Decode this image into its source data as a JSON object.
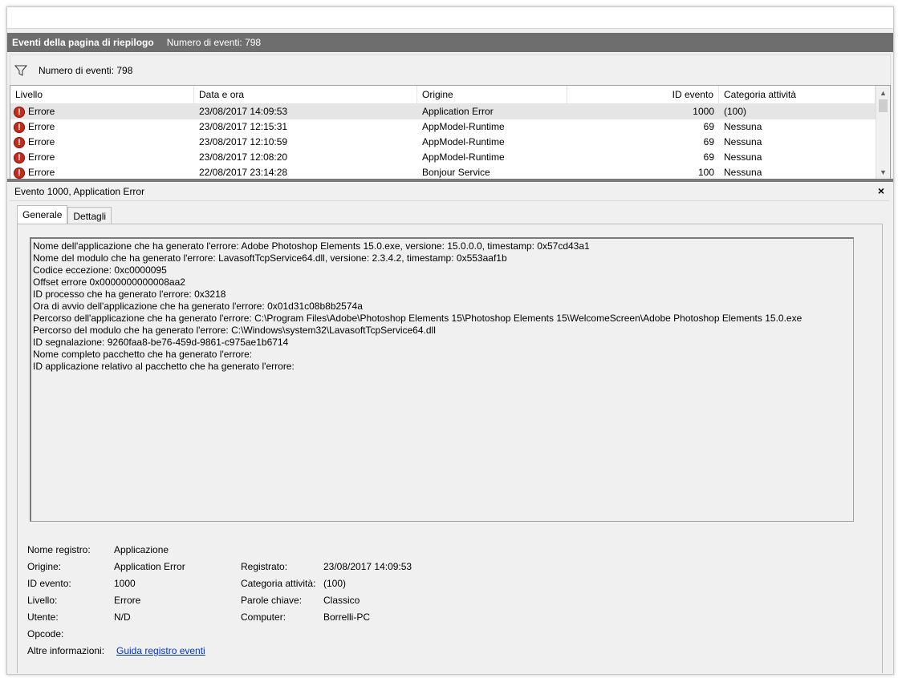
{
  "header": {
    "title": "Eventi della pagina di riepilogo",
    "count": "Numero di eventi: 798"
  },
  "filter": {
    "icon": "filter-icon",
    "text": "Numero di eventi: 798"
  },
  "grid": {
    "columns": {
      "level": "Livello",
      "datetime": "Data e ora",
      "source": "Origine",
      "event_id": "ID evento",
      "category": "Categoria attività"
    },
    "rows": [
      {
        "level": "Errore",
        "datetime": "23/08/2017 14:09:53",
        "source": "Application Error",
        "event_id": "1000",
        "category": "(100)"
      },
      {
        "level": "Errore",
        "datetime": "23/08/2017 12:15:31",
        "source": "AppModel-Runtime",
        "event_id": "69",
        "category": "Nessuna"
      },
      {
        "level": "Errore",
        "datetime": "23/08/2017 12:10:59",
        "source": "AppModel-Runtime",
        "event_id": "69",
        "category": "Nessuna"
      },
      {
        "level": "Errore",
        "datetime": "23/08/2017 12:08:20",
        "source": "AppModel-Runtime",
        "event_id": "69",
        "category": "Nessuna"
      },
      {
        "level": "Errore",
        "datetime": "22/08/2017 23:14:28",
        "source": "Bonjour Service",
        "event_id": "100",
        "category": "Nessuna"
      }
    ]
  },
  "detail": {
    "title": "Evento 1000, Application Error",
    "close": "×",
    "tabs": {
      "general": "Generale",
      "details": "Dettagli"
    },
    "message": [
      "Nome dell'applicazione che ha generato l'errore: Adobe Photoshop Elements 15.0.exe, versione: 15.0.0.0, timestamp: 0x57cd43a1",
      "Nome del modulo che ha generato l'errore: LavasoftTcpService64.dll, versione: 2.3.4.2, timestamp: 0x553aaf1b",
      "Codice eccezione: 0xc0000095",
      "Offset errore 0x0000000000008aa2",
      "ID processo che ha generato l'errore: 0x3218",
      "Ora di avvio dell'applicazione che ha generato l'errore: 0x01d31c08b8b2574a",
      "Percorso dell'applicazione che ha generato l'errore: C:\\Program Files\\Adobe\\Photoshop Elements 15\\Photoshop Elements 15\\WelcomeScreen\\Adobe Photoshop Elements 15.0.exe",
      "Percorso del modulo che ha generato l'errore: C:\\Windows\\system32\\LavasoftTcpService64.dll",
      "ID segnalazione: 9260faa8-be76-459d-9861-c975ae1b6714",
      "Nome completo pacchetto che ha generato l'errore:",
      "ID applicazione relativo al pacchetto che ha generato l'errore:"
    ],
    "props": {
      "log_name_label": "Nome registro:",
      "log_name": "Applicazione",
      "source_label": "Origine:",
      "source": "Application Error",
      "logged_label": "Registrato:",
      "logged": "23/08/2017 14:09:53",
      "event_id_label": "ID evento:",
      "event_id": "1000",
      "category_label": "Categoria attività:",
      "category": "(100)",
      "level_label": "Livello:",
      "level": "Errore",
      "keywords_label": "Parole chiave:",
      "keywords": "Classico",
      "user_label": "Utente:",
      "user": "N/D",
      "computer_label": "Computer:",
      "computer": "Borrelli-PC",
      "opcode_label": "Opcode:",
      "more_info_label": "Altre informazioni:",
      "more_info_link": "Guida registro eventi"
    }
  },
  "colors": {
    "header_bg": "#6e6e6e",
    "error_icon": "#c42b1c",
    "link": "#0033cc",
    "selection": "#e5e5e5"
  }
}
